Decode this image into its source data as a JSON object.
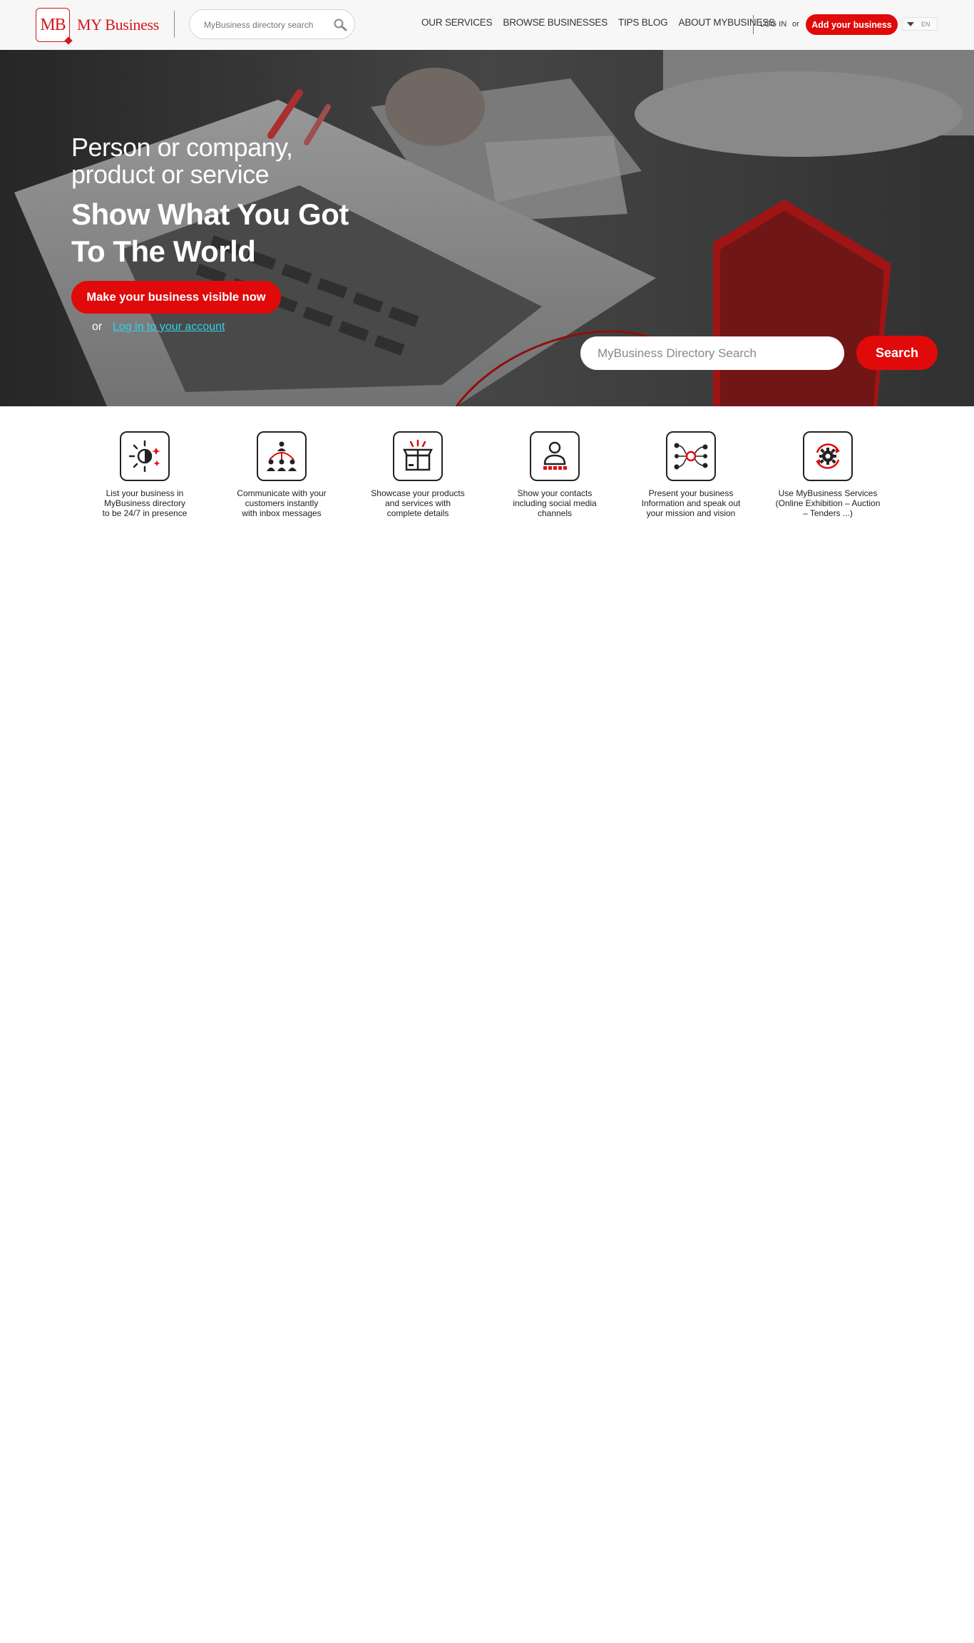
{
  "brand": {
    "logo_mark": "MB",
    "name": "MY Business",
    "accent_color": "#e10a0a"
  },
  "header": {
    "search_placeholder": "MyBusiness directory search",
    "nav": [
      "OUR SERVICES",
      "BROWSE BUSINESSES",
      "TIPS BLOG",
      "ABOUT MYBUSINESS"
    ],
    "login": "LOG IN",
    "or": "or",
    "add_business": "Add your business",
    "language": "EN"
  },
  "hero": {
    "headline": "Person or company, product or service",
    "tagline": "Show What You Got To The World",
    "cta": "Make your business visible now",
    "or": "or",
    "login_link": "Log in to your account",
    "search_placeholder": "MyBusiness Directory Search",
    "search_button": "Search"
  },
  "features": [
    {
      "icon": "brightness-sun-icon",
      "label": "List your business in\nMyBusiness directory\nto be 24/7 in presence"
    },
    {
      "icon": "audience-people-icon",
      "label": "Communicate with your\ncustomers instantly\nwith inbox messages"
    },
    {
      "icon": "open-box-icon",
      "label": "Showcase your products\nand services with\ncomplete details"
    },
    {
      "icon": "contact-person-icon",
      "label": "Show your contacts\nincluding social media\nchannels"
    },
    {
      "icon": "network-nodes-icon",
      "label": "Present your business\nInformation and speak out\nyour mission and vision"
    },
    {
      "icon": "gear-cycle-icon",
      "label": "Use MyBusiness Services\n(Online Exhibition – Auction\n– Tenders ...)"
    }
  ]
}
